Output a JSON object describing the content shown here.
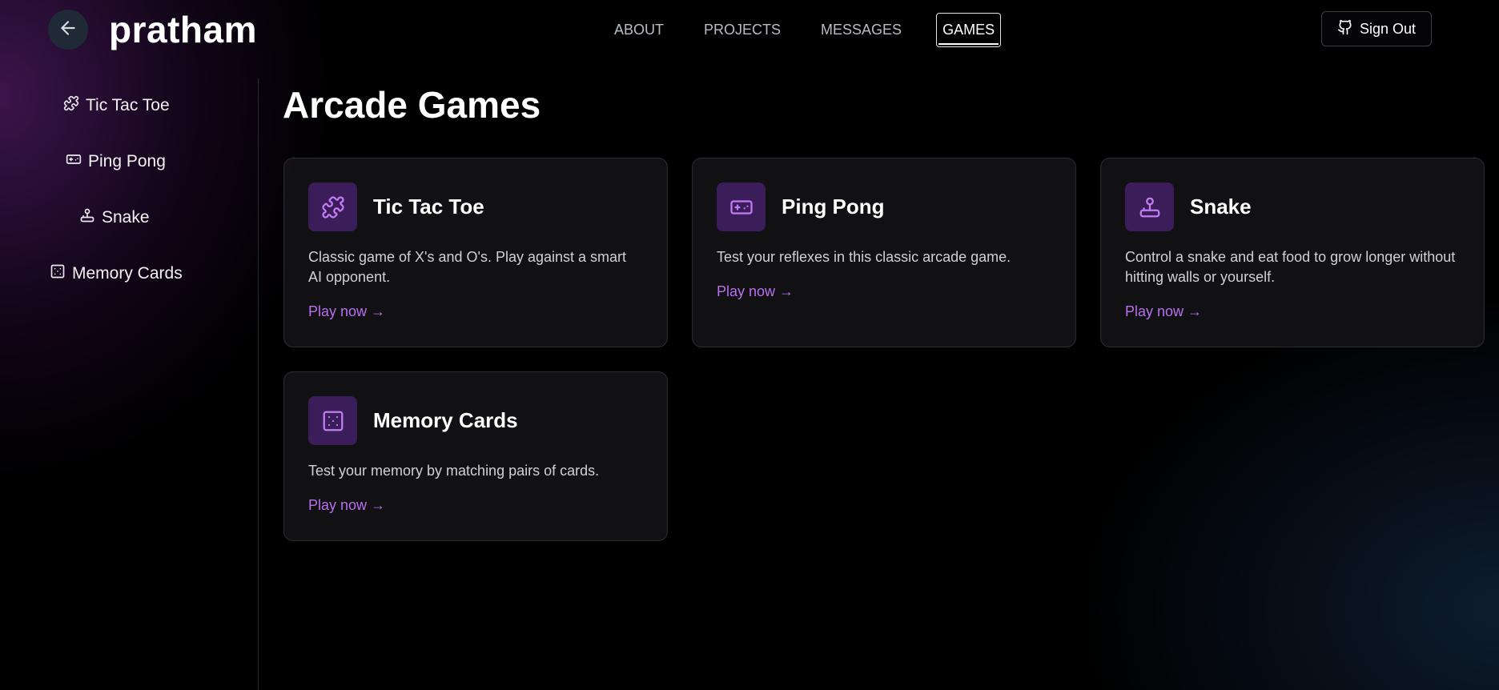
{
  "header": {
    "brand": "pratham",
    "nav": [
      {
        "label": "ABOUT",
        "active": false
      },
      {
        "label": "PROJECTS",
        "active": false
      },
      {
        "label": "MESSAGES",
        "active": false
      },
      {
        "label": "GAMES",
        "active": true
      }
    ],
    "sign_out_label": "Sign Out"
  },
  "sidebar": {
    "items": [
      {
        "label": "Tic Tac Toe",
        "icon": "puzzle-icon"
      },
      {
        "label": "Ping Pong",
        "icon": "gamepad-icon"
      },
      {
        "label": "Snake",
        "icon": "joystick-icon"
      },
      {
        "label": "Memory Cards",
        "icon": "dice-icon"
      }
    ]
  },
  "main": {
    "title": "Arcade Games",
    "cards": [
      {
        "title": "Tic Tac Toe",
        "icon": "puzzle-icon",
        "description": "Classic game of X's and O's. Play against a smart AI opponent.",
        "link": "Play now →"
      },
      {
        "title": "Ping Pong",
        "icon": "gamepad-icon",
        "description": "Test your reflexes in this classic arcade game.",
        "link": "Play now →"
      },
      {
        "title": "Snake",
        "icon": "joystick-icon",
        "description": "Control a snake and eat food to grow longer without hitting walls or yourself.",
        "link": "Play now →"
      },
      {
        "title": "Memory Cards",
        "icon": "dice-icon",
        "description": "Test your memory by matching pairs of cards.",
        "link": "Play now →"
      }
    ]
  },
  "colors": {
    "accent": "#b86ff0",
    "icon_bg": "#3b1d5a",
    "background": "#000000"
  }
}
